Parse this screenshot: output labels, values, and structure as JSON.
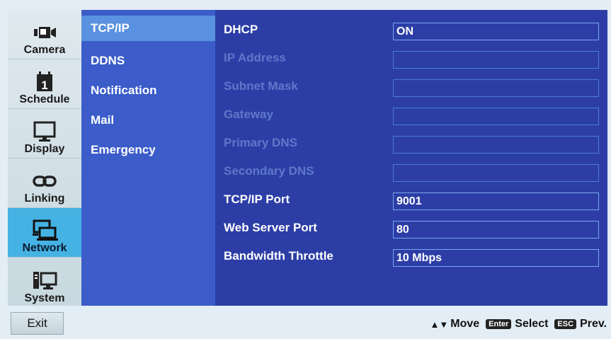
{
  "rail": [
    {
      "label": "Camera",
      "icon": "camera-icon"
    },
    {
      "label": "Schedule",
      "icon": "calendar-icon"
    },
    {
      "label": "Display",
      "icon": "monitor-icon"
    },
    {
      "label": "Linking",
      "icon": "link-icon"
    },
    {
      "label": "Network",
      "icon": "network-icon",
      "active": true
    },
    {
      "label": "System",
      "icon": "computer-icon"
    }
  ],
  "submenu": [
    {
      "label": "TCP/IP",
      "active": true
    },
    {
      "label": "DDNS"
    },
    {
      "label": "Notification"
    },
    {
      "label": "Mail"
    },
    {
      "label": "Emergency"
    }
  ],
  "settings": [
    {
      "label": "DHCP",
      "value": "ON",
      "enabled": true
    },
    {
      "label": "IP Address",
      "value": "",
      "enabled": false
    },
    {
      "label": "Subnet Mask",
      "value": "",
      "enabled": false
    },
    {
      "label": "Gateway",
      "value": "",
      "enabled": false
    },
    {
      "label": "Primary DNS",
      "value": "",
      "enabled": false
    },
    {
      "label": "Secondary DNS",
      "value": "",
      "enabled": false
    },
    {
      "label": "TCP/IP Port",
      "value": "9001",
      "enabled": true
    },
    {
      "label": "Web Server Port",
      "value": "80",
      "enabled": true
    },
    {
      "label": "Bandwidth Throttle",
      "value": "10 Mbps",
      "enabled": true
    }
  ],
  "footer": {
    "exit_label": "Exit",
    "move_label": "Move",
    "enter_key": "Enter",
    "select_label": "Select",
    "esc_key": "ESC",
    "prev_label": "Prev."
  },
  "colors": {
    "background": "#2c3ea6",
    "submenu": "#3b5cc9",
    "active_submenu": "#5a91e0",
    "active_rail": "#45b2e4",
    "disabled_text": "#5e78c9"
  }
}
